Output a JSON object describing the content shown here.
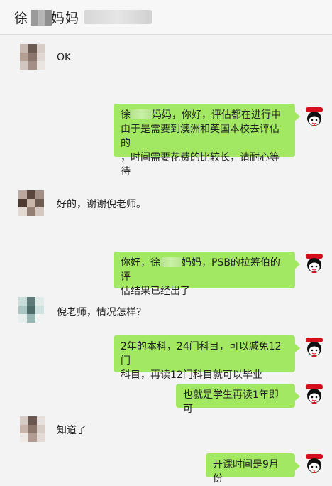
{
  "header": {
    "title_prefix": "徐",
    "title_suffix": "妈妈"
  },
  "messages": [
    {
      "side": "left",
      "text": "OK"
    },
    {
      "side": "right",
      "lines": [
        "徐",
        "妈妈，你好，评估都在进行中",
        "由于是需要到澳洲和英国本校去评估的",
        "，时间需要花费的比较长，请耐心等待"
      ]
    },
    {
      "side": "left",
      "text": "好的，谢谢倪老师。"
    },
    {
      "side": "right",
      "lines": [
        "你好，徐",
        "妈妈，PSB的拉筹伯的评",
        "估结果已经出了"
      ]
    },
    {
      "side": "left",
      "text": "倪老师，情况怎样？"
    },
    {
      "side": "right",
      "lines": [
        "2年的本科，24门科目，可以减免12门",
        "科目，再读12门科目就可以毕业"
      ]
    },
    {
      "side": "right",
      "text": "也就是学生再读1年即可"
    },
    {
      "side": "left",
      "text": "知道了"
    },
    {
      "side": "right",
      "text": "开课时间是9月份"
    }
  ],
  "colors": {
    "bubble_green": "#a3e863",
    "background": "#f3f3f3"
  }
}
